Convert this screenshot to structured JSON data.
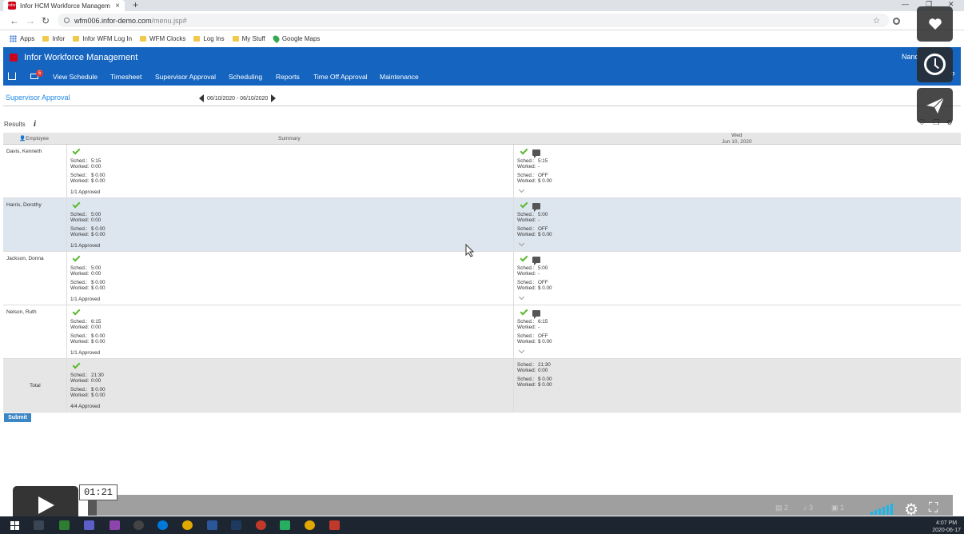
{
  "browser": {
    "tab_title": "Infor HCM Workforce Managem",
    "tab_favicon_text": "infor",
    "url_host": "wfm006.infor-demo.com",
    "url_path": "/menu.jsp#",
    "bookmarks": [
      {
        "label": "Apps",
        "icon": "apps-grid-icon"
      },
      {
        "label": "Infor",
        "icon": "folder-icon"
      },
      {
        "label": "Infor WFM Log In",
        "icon": "folder-icon"
      },
      {
        "label": "WFM Clocks",
        "icon": "folder-icon"
      },
      {
        "label": "Log Ins",
        "icon": "folder-icon"
      },
      {
        "label": "My Stuff",
        "icon": "folder-icon"
      },
      {
        "label": "Google Maps",
        "icon": "maps-pin-icon"
      }
    ]
  },
  "app": {
    "title": "Infor Workforce Management",
    "user": "Nanc",
    "mail_count": "5",
    "menu": [
      "View Schedule",
      "Timesheet",
      "Supervisor Approval",
      "Scheduling",
      "Reports",
      "Time Off Approval",
      "Maintenance"
    ],
    "help": "?"
  },
  "page": {
    "title": "Supervisor Approval",
    "date_range": "06/10/2020 - 06/10/2020",
    "results_label": "Results",
    "info_glyph": "i",
    "columns": {
      "employee": "Employee",
      "summary": "Summary",
      "day_name": "Wed",
      "day_date": "Jun 10, 2020"
    },
    "rows": [
      {
        "name": "Davis, Kenneth",
        "sum_sched_hours": "5:15",
        "sum_worked_hours": "0:00",
        "sum_sched_amt": "$ 0.00",
        "sum_worked_amt": "$ 0.00",
        "approved": "1/1 Approved",
        "day_sched_hours": "5:15",
        "day_worked_hours": "-",
        "day_sched_amt": "OFF",
        "day_worked_amt": "$ 0.00"
      },
      {
        "name": "Harris, Dorothy",
        "sum_sched_hours": "5:00",
        "sum_worked_hours": "0:00",
        "sum_sched_amt": "$ 0.00",
        "sum_worked_amt": "$ 0.00",
        "approved": "1/1 Approved",
        "day_sched_hours": "5:00",
        "day_worked_hours": "-",
        "day_sched_amt": "OFF",
        "day_worked_amt": "$ 0.00"
      },
      {
        "name": "Jackson, Donna",
        "sum_sched_hours": "5:00",
        "sum_worked_hours": "0:00",
        "sum_sched_amt": "$ 0.00",
        "sum_worked_amt": "$ 0.00",
        "approved": "1/1 Approved",
        "day_sched_hours": "5:00",
        "day_worked_hours": "-",
        "day_sched_amt": "OFF",
        "day_worked_amt": "$ 0.00"
      },
      {
        "name": "Nelson, Ruth",
        "sum_sched_hours": "6:15",
        "sum_worked_hours": "0:00",
        "sum_sched_amt": "$ 0.00",
        "sum_worked_amt": "$ 0.00",
        "approved": "1/1 Approved",
        "day_sched_hours": "6:15",
        "day_worked_hours": "-",
        "day_sched_amt": "OFF",
        "day_worked_amt": "$ 0.00"
      }
    ],
    "total": {
      "label": "Total",
      "sum_sched_hours": "21:30",
      "sum_worked_hours": "0:00",
      "sum_sched_amt": "$ 0.00",
      "sum_worked_amt": "$ 0.00",
      "approved": "4/4 Approved",
      "day_sched_hours": "21:30",
      "day_worked_hours": "0:00",
      "day_sched_amt": "$ 0.00",
      "day_worked_amt": "$ 0.00"
    },
    "labels": {
      "sched": "Sched.:",
      "worked": "Worked:"
    },
    "submit_label": "Submit"
  },
  "video": {
    "current_time": "01:21",
    "progress_fraction": 0.01,
    "taskbar_time": "4:07 PM",
    "taskbar_date": "2020-06-17",
    "tray_counts": [
      "2",
      "3",
      "1"
    ]
  },
  "colors": {
    "brand_blue": "#1565c0",
    "link_blue": "#1e88e5",
    "approve_green": "#5cb82e",
    "row_alt": "#dde5ee",
    "vimeo_blue": "#1ab7ea"
  }
}
